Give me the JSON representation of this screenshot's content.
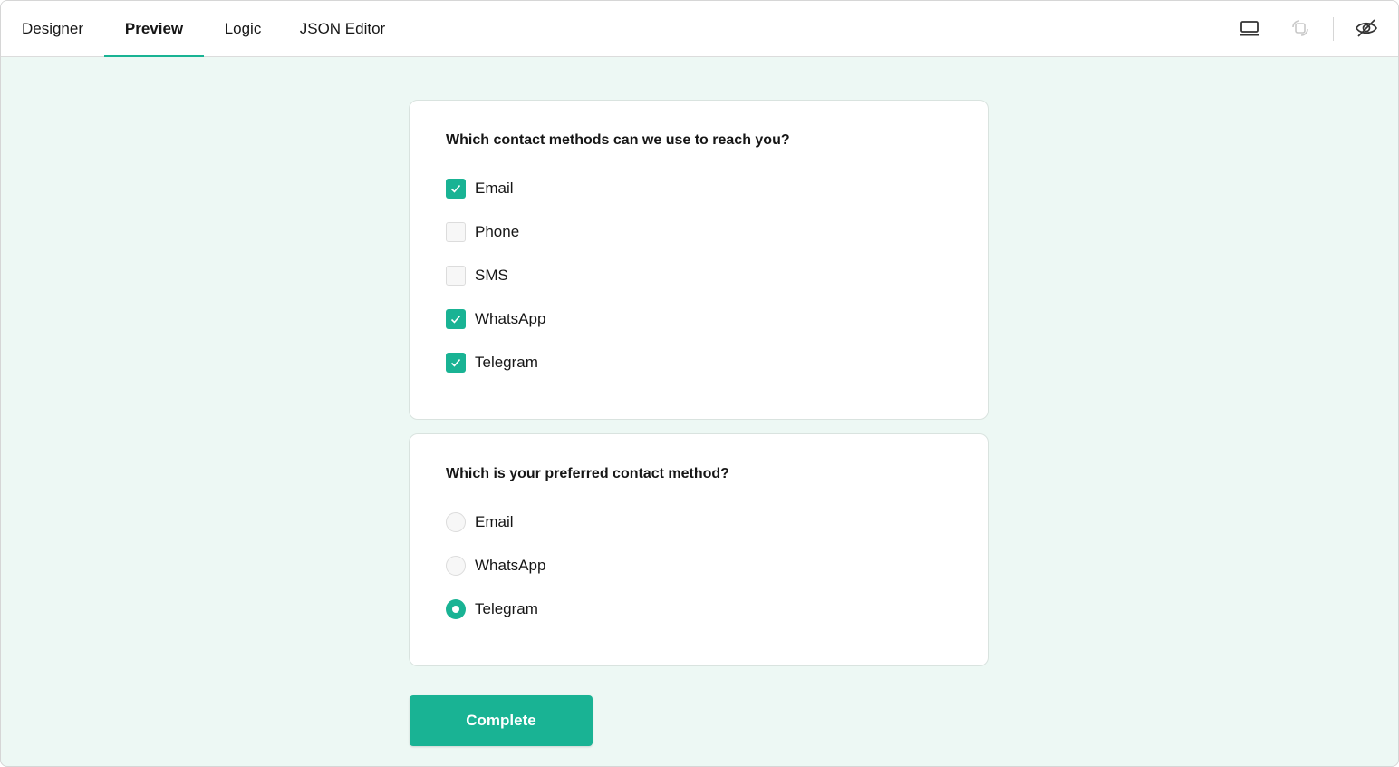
{
  "tabs": [
    {
      "label": "Designer",
      "active": false
    },
    {
      "label": "Preview",
      "active": true
    },
    {
      "label": "Logic",
      "active": false
    },
    {
      "label": "JSON Editor",
      "active": false
    }
  ],
  "toolbar": {
    "icons": [
      "laptop-icon",
      "orientation-icon",
      "eye-off-icon"
    ]
  },
  "question1": {
    "title": "Which contact methods can we use to reach you?",
    "type": "checkbox",
    "options": [
      {
        "label": "Email",
        "checked": true
      },
      {
        "label": "Phone",
        "checked": false
      },
      {
        "label": "SMS",
        "checked": false
      },
      {
        "label": "WhatsApp",
        "checked": true
      },
      {
        "label": "Telegram",
        "checked": true
      }
    ]
  },
  "question2": {
    "title": "Which is your preferred contact method?",
    "type": "radio",
    "options": [
      {
        "label": "Email",
        "selected": false
      },
      {
        "label": "WhatsApp",
        "selected": false
      },
      {
        "label": "Telegram",
        "selected": true
      }
    ]
  },
  "complete_label": "Complete",
  "colors": {
    "accent": "#19b394",
    "background": "#edf8f4"
  }
}
